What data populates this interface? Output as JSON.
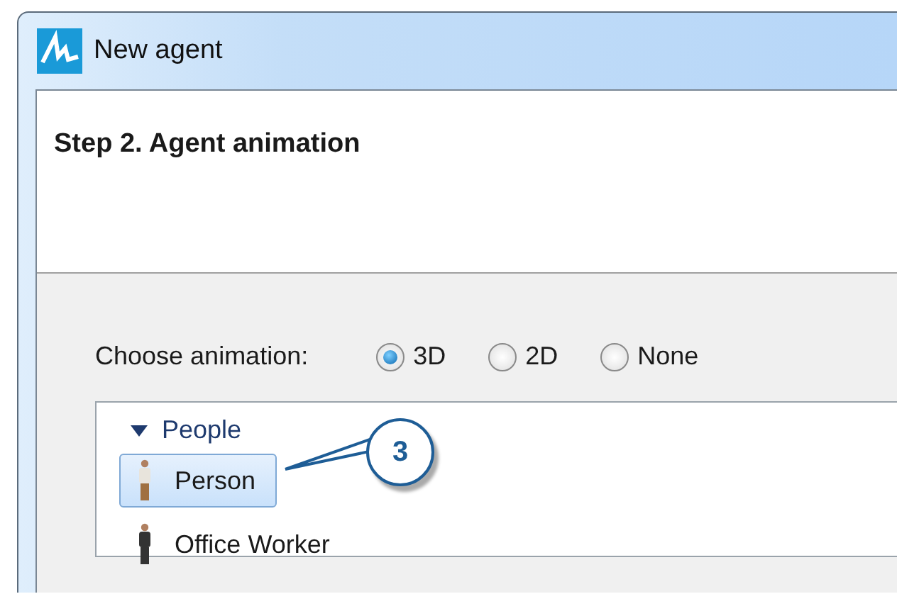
{
  "window": {
    "title": "New agent"
  },
  "header": {
    "title": "Step 2. Agent animation"
  },
  "animation": {
    "label": "Choose animation:",
    "options": [
      {
        "label": "3D",
        "selected": true
      },
      {
        "label": "2D",
        "selected": false
      },
      {
        "label": "None",
        "selected": false
      }
    ]
  },
  "list": {
    "groups": [
      {
        "label": "People",
        "expanded": true,
        "children": [
          {
            "label": "Person",
            "selected": true,
            "kind": "casual"
          },
          {
            "label": "Office Worker",
            "selected": false,
            "kind": "suit"
          }
        ]
      }
    ]
  },
  "callout": {
    "number": "3"
  }
}
